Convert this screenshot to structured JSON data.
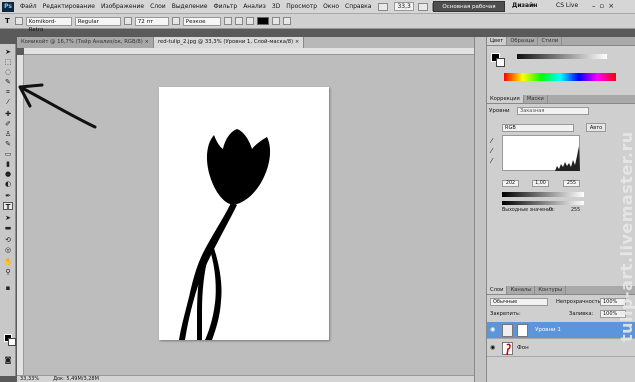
{
  "app": {
    "logo": "Ps",
    "menus": [
      "Файл",
      "Редактирование",
      "Изображение",
      "Слои",
      "Выделение",
      "Фильтр",
      "Анализ",
      "3D",
      "Просмотр",
      "Окно",
      "Справка"
    ],
    "zoom": "33,3",
    "workspace_button": "Основная рабочая среда",
    "workspace_design": "Дизайн",
    "workspace_more": "»",
    "cs_live": "CS Live",
    "window_buttons": [
      "–",
      "▫",
      "×"
    ]
  },
  "options": {
    "tool_glyph": "T",
    "font_family": "Komikord-Retro",
    "font_style": "Regular",
    "font_size": "72 пт",
    "antialias": "Резкое",
    "text_color": "#000000"
  },
  "documents": {
    "tabs": [
      {
        "label": "Комикойт @ 16,7% (Тейр Анализ/ок, RGB/8) ×",
        "active": false
      },
      {
        "label": "red-tulip_2.jpg @ 33,3% (Уровни 1, Слой-маска/8) ×",
        "active": true
      }
    ]
  },
  "status": {
    "zoom": "33,33%",
    "doc": "Док: 5,49M/3,28M"
  },
  "panels": {
    "color_tabs": [
      "Цвет",
      "Образцы",
      "Стили"
    ],
    "adjust_tabs": [
      "Коррекция",
      "Маски"
    ],
    "levels_title": "Уровни",
    "levels_preset": "Заказная",
    "channel": "RGB",
    "auto_label": "Авто",
    "input_values": [
      "202",
      "1,00",
      "255"
    ],
    "output_label": "Выходные значения:",
    "output_values": [
      "0",
      "255"
    ],
    "layers_tabs": [
      "Слои",
      "Каналы",
      "Контуры"
    ],
    "blend_mode": "Обычные",
    "opacity_label": "Непрозрачность:",
    "opacity_value": "100%",
    "lock_label": "Закрепить:",
    "fill_label": "Заливка:",
    "fill_value": "100%",
    "layers": [
      {
        "name": "Уровни 1",
        "selected": true
      },
      {
        "name": "Фон",
        "selected": false
      }
    ]
  },
  "watermark": "tulip-art.livemaster.ru",
  "colors": {
    "selected_layer": "#5c95d9",
    "workspace_button": "#4e4e4e"
  }
}
